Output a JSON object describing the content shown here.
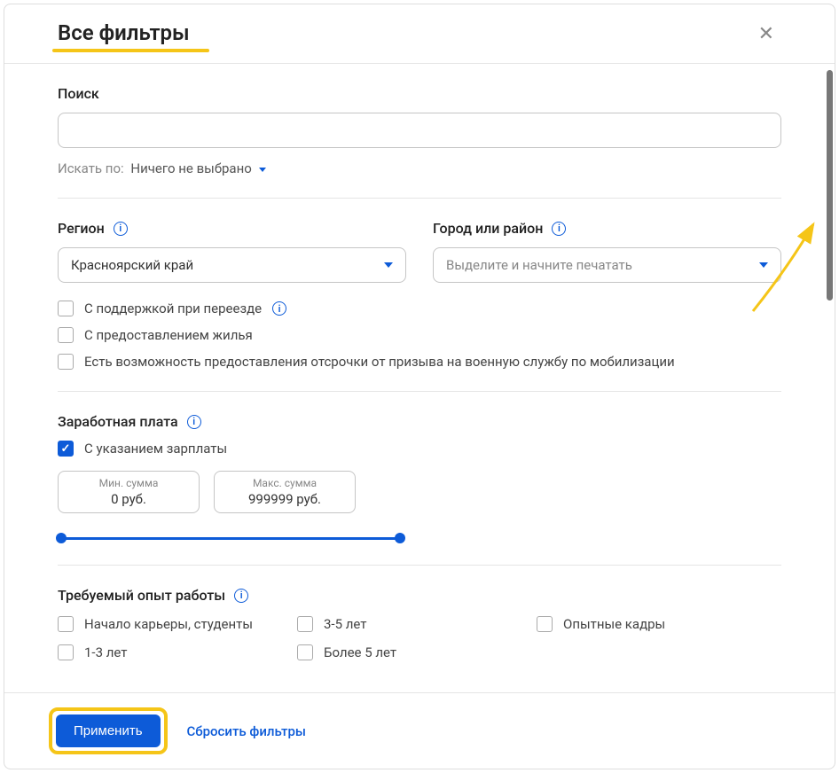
{
  "header": {
    "title": "Все фильтры"
  },
  "search": {
    "label": "Поиск",
    "value": "",
    "searchByLabel": "Искать по:",
    "searchBySelected": "Ничего не выбрано"
  },
  "region": {
    "label": "Регион",
    "selected": "Красноярский край"
  },
  "city": {
    "label": "Город или район",
    "placeholder": "Выделите и начните печатать"
  },
  "regionCheckboxes": {
    "relocation": "С поддержкой при переезде",
    "housing": "С предоставлением жилья",
    "deferral": "Есть возможность предоставления отсрочки от призыва на военную службу по мобилизации"
  },
  "salary": {
    "label": "Заработная плата",
    "withSalaryLabel": "С указанием зарплаты",
    "minLabel": "Мин. сумма",
    "minValue": "0 руб.",
    "maxLabel": "Макс. сумма",
    "maxValue": "999999 руб."
  },
  "experience": {
    "label": "Требуемый опыт работы",
    "options": {
      "start": "Начало карьеры, студенты",
      "y3_5": "3-5 лет",
      "expert": "Опытные кадры",
      "y1_3": "1-3 лет",
      "y5plus": "Более 5 лет"
    }
  },
  "footer": {
    "apply": "Применить",
    "reset": "Сбросить фильтры"
  }
}
